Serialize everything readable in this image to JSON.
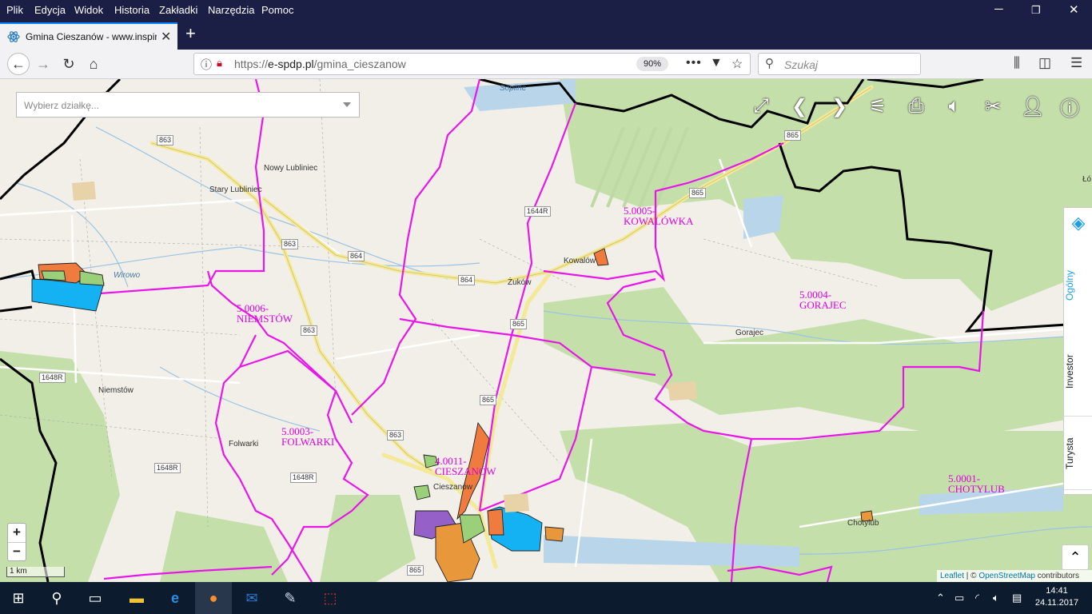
{
  "menu": [
    "Plik",
    "Edycja",
    "Widok",
    "Historia",
    "Zakładki",
    "Narzędzia",
    "Pomoc"
  ],
  "tab": {
    "title": "Gmina Cieszanów - www.inspir",
    "close": "✕"
  },
  "newtab": "+",
  "url": {
    "scheme": "https://",
    "host": "e-spdp.pl",
    "path": "/gmina_cieszanow",
    "zoom": "90%"
  },
  "search": {
    "placeholder": "Szukaj"
  },
  "map": {
    "select_placeholder": "Wybierz działkę...",
    "side_tabs": [
      "Ogólny",
      "Investor",
      "Turysta"
    ],
    "scale": "1 km",
    "zoom_in": "+",
    "zoom_out": "−",
    "attribution": {
      "leaflet": "Leaflet",
      "sep": " | © ",
      "osm": "OpenStreetMap",
      "rest": " contributors"
    },
    "precincts": [
      {
        "code": "5.0005-",
        "name": "KOWALÓWKA"
      },
      {
        "code": "5.0004-",
        "name": "GORAJEC"
      },
      {
        "code": "5.0006-",
        "name": "NIEMSTÓW"
      },
      {
        "code": "5.0003-",
        "name": "FOLWARKI"
      },
      {
        "code": "4.0011-",
        "name": "CIESZANÓW"
      },
      {
        "code": "5.0001-",
        "name": "CHOTYLUB"
      }
    ],
    "towns": [
      "Nowy Lubliniec",
      "Stary Lubliniec",
      "Kowalów",
      "Żuków",
      "Gorajec",
      "Niemstów",
      "Folwarki",
      "Cieszanów",
      "Chotylub",
      "Sopilne",
      "Łó",
      "Wirowo"
    ],
    "roads": [
      "863",
      "863",
      "864",
      "864",
      "865",
      "865",
      "865",
      "865",
      "863",
      "863",
      "1644R",
      "1648R",
      "1648R",
      "1648R",
      "865"
    ]
  },
  "clock": {
    "time": "14:41",
    "date": "24.11.2017"
  },
  "colors": {
    "commune_border": "#e817e8",
    "gmina_border": "#000000",
    "firefox_dark": "#1c1f45",
    "taskbar": "#0d1b2e"
  }
}
